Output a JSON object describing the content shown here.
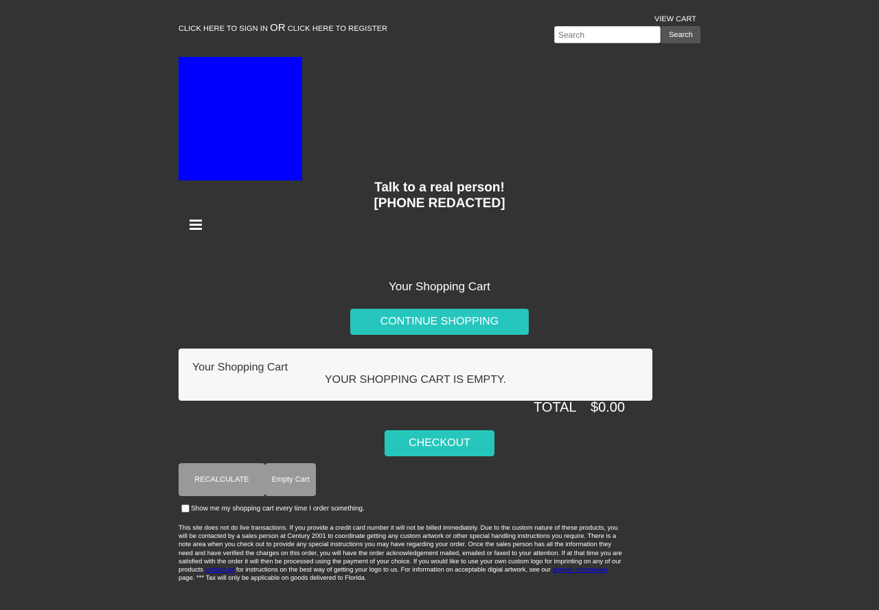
{
  "header": {
    "sign_in": "CLICK HERE TO SIGN IN",
    "or": "OR",
    "register": "CLICK HERE TO REGISTER",
    "view_cart": "VIEW CART",
    "search_placeholder": "Search",
    "search_button": "Search"
  },
  "branding": {
    "logo_color": "#0000ff",
    "tagline": "Talk to a real person!",
    "phone": "[PHONE REDACTED]"
  },
  "cart": {
    "heading": "Your Shopping Cart",
    "continue_label": "CONTINUE SHOPPING",
    "box_title": "Your Shopping Cart",
    "empty_message": "YOUR SHOPPING CART IS EMPTY.",
    "total_label": "TOTAL",
    "total_value": "$0.00",
    "checkout_label": "CHECKOUT",
    "recalculate_label": "RECALCULATE",
    "empty_cart_label": "Empty Cart",
    "remember_label": "Show me my shopping cart every time I order something."
  },
  "disclaimer": {
    "part1": "This site does not do live transactions. If you provide a credit card number it will not be billed immediately. Due to the custom nature of these products, you will be contacted by a sales person at Century 2001 to coordinate getting any custom artwork or other special handling instructions you require. There is a note area when you check out to provide any special instructions you may have regarding your order. Once the sales person has all the information they need and have verified the charges on this order, you will have the order acknowledgement mailed, emailed or faxed to your attention. If at that time you are satisfied with the order it will then be processed using the payment of your choice. If you would like to use your own custom logo for imprinting on any of our products ",
    "contact_link": "contact us",
    "part2": " for instructions on the best way of getting your logo to us. For information on acceptable digial artwork, see our ",
    "artwork_link": "artwork information",
    "part3": " page. *** Tax will only be applicable on goods delivered to Florida."
  },
  "colors": {
    "background": "#333333",
    "accent_teal": "#26c6bd",
    "secondary_gray": "#999999",
    "cart_box": "#f7f7f7"
  }
}
